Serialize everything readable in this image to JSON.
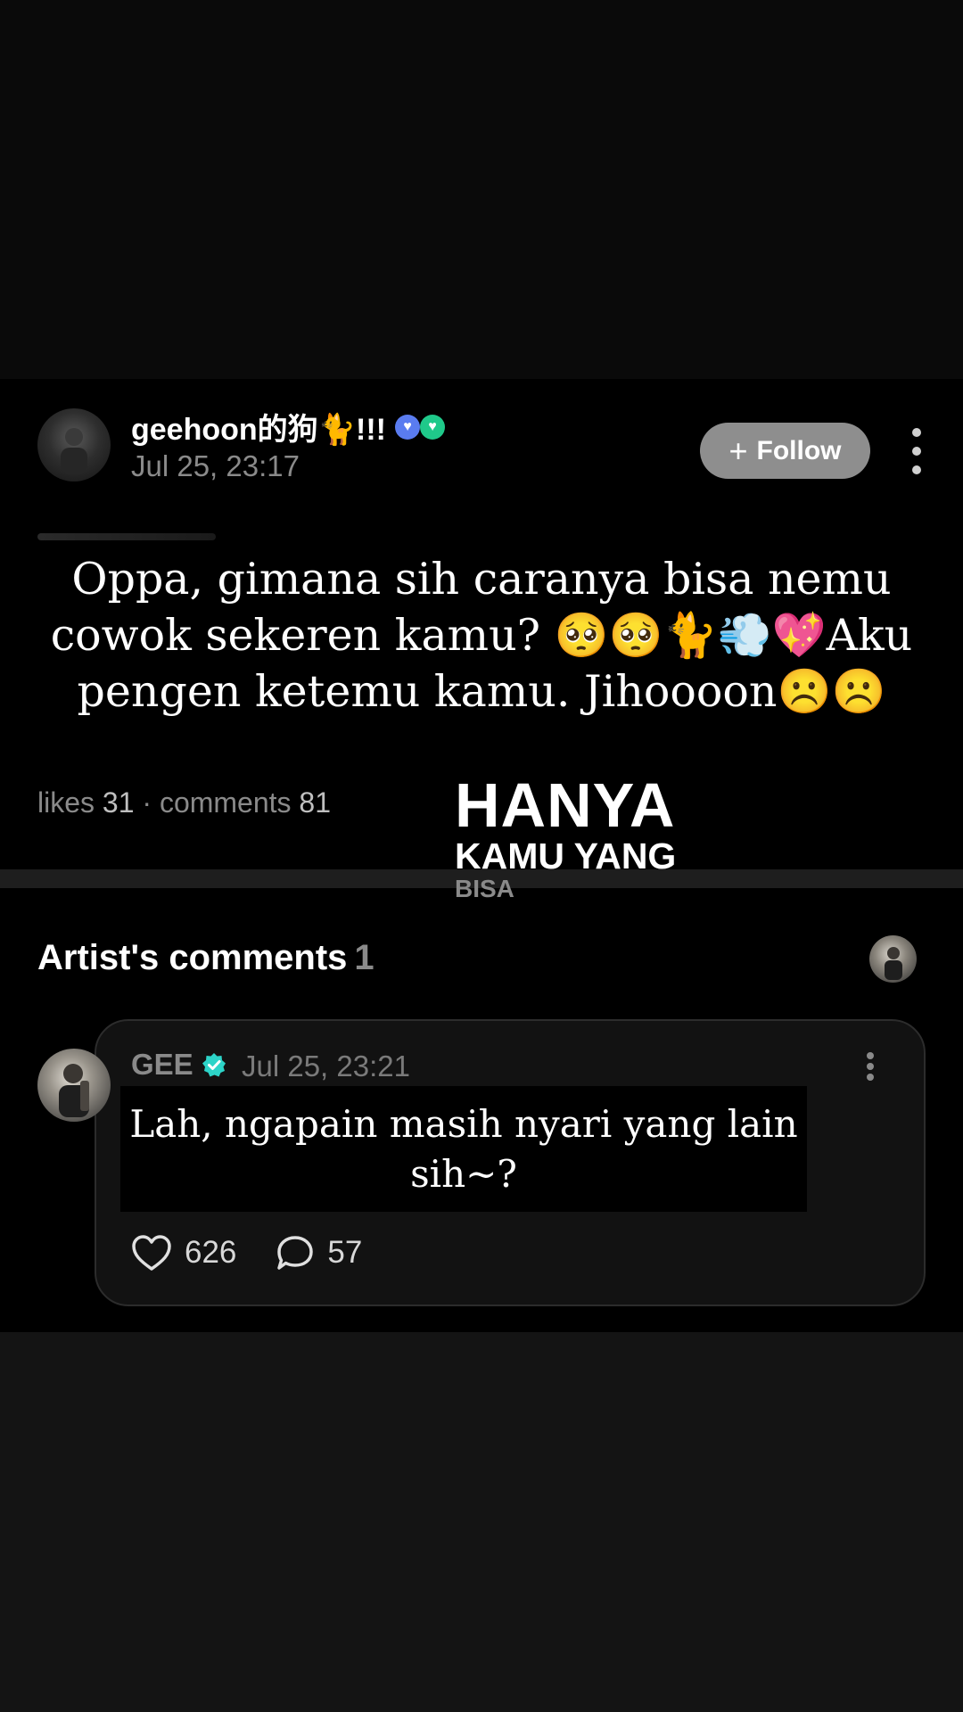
{
  "post": {
    "username": "geehoon的狗🐈!!!",
    "date": "Jul 25, 23:17",
    "follow_label": "Follow",
    "follow_plus": "+",
    "text": "Oppa, gimana sih caranya bisa nemu cowok sekeren kamu? 🥺🥺🐈💨💖Aku pengen ketemu kamu. Jihoooon☹️☹️",
    "likes_label": "likes",
    "likes_count": "31",
    "separator": "·",
    "comments_label": "comments",
    "comments_count": "81"
  },
  "overlay": {
    "line1": "HANYA",
    "line2": "KAMU YANG",
    "line3": "BISA"
  },
  "artist_comments": {
    "heading": "Artist's comments",
    "count": "1"
  },
  "comment": {
    "author": "GEE",
    "date": "Jul 25, 23:21",
    "text": "Lah, ngapain masih nyari yang lain sih~?",
    "likes": "626",
    "replies": "57"
  },
  "icons": {
    "badge_1": "shield-heart-icon",
    "badge_2": "heart-check-icon",
    "verified": "verified-check-icon",
    "like": "heart-outline-icon",
    "reply": "speech-bubble-icon",
    "more": "more-vertical-icon"
  },
  "colors": {
    "background_top": "#0a0a0a",
    "background_post": "#000000",
    "background_bottom": "#141414",
    "follow_button": "#8e8e8e",
    "verified": "#2dd4c8",
    "muted_text": "#8a8a8a"
  }
}
